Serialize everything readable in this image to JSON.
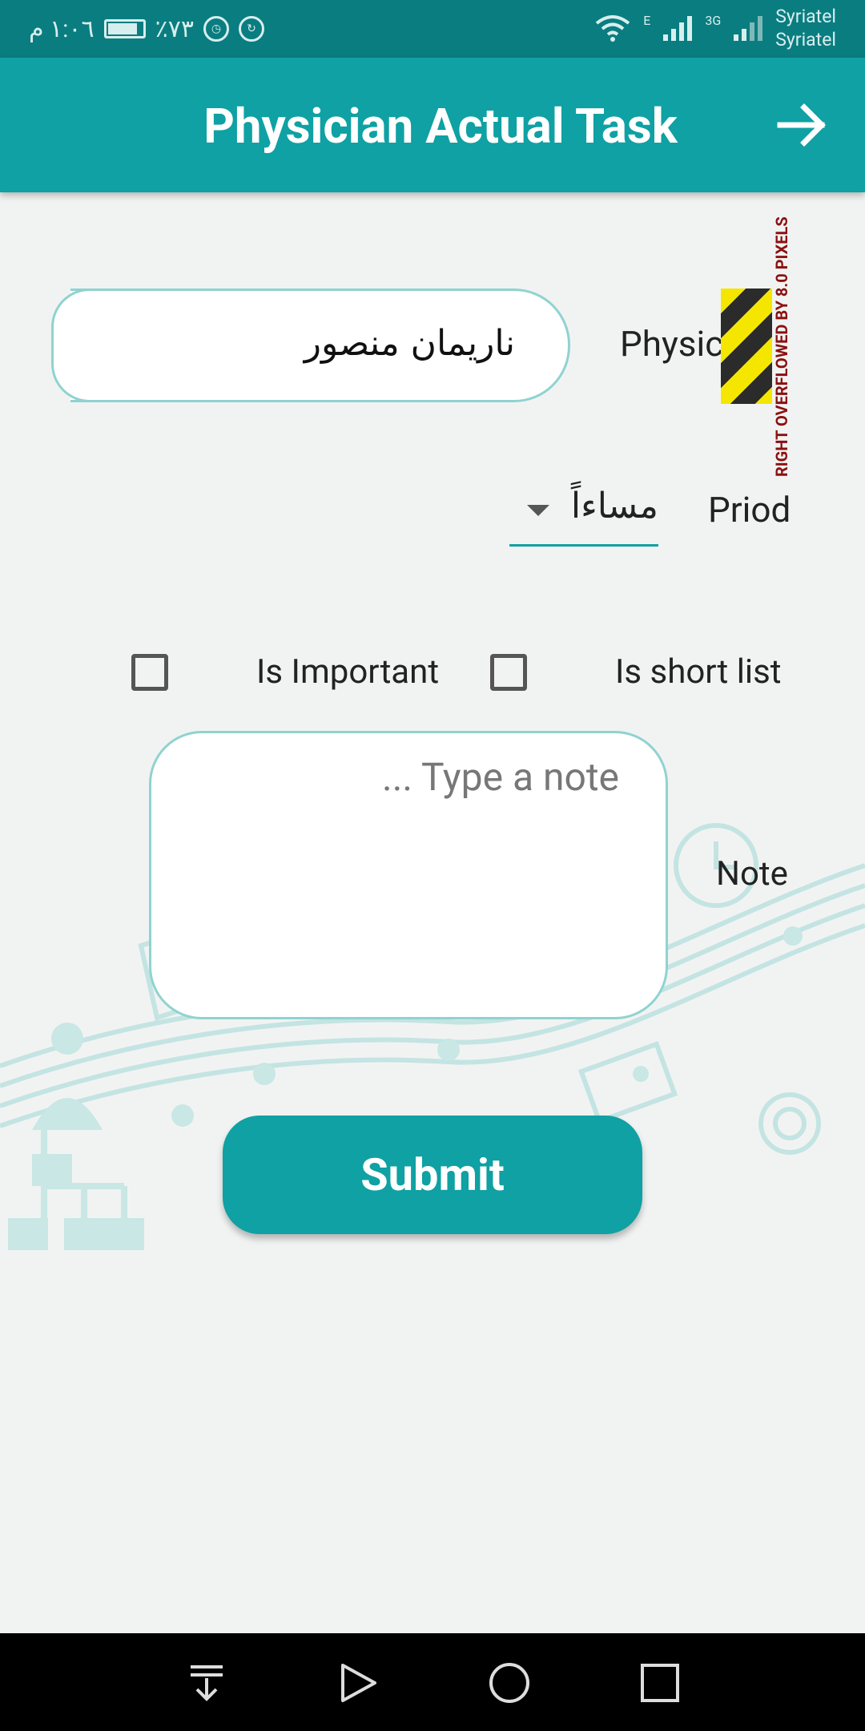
{
  "status_bar": {
    "time": "١:٠٦ م",
    "battery": "٪٧٣",
    "carrier_1": "Syriatel",
    "carrier_2": "Syriatel",
    "network_1": "E",
    "network_2": "3G"
  },
  "app_bar": {
    "title": "Physician Actual Task"
  },
  "form": {
    "physician_label": "Physician",
    "physician_value": "ناريمان منصور",
    "period_label": "Priod",
    "period_value": "مساءاً",
    "is_important_label": "Is Important",
    "is_short_list_label": "Is short list",
    "note_label": "Note",
    "note_placeholder": "... Type a note",
    "submit_label": "Submit",
    "overflow_warning": "RIGHT OVERFLOWED BY 8.0 PIXELS"
  },
  "colors": {
    "primary": "#0fa1a3",
    "status_bar": "#0a7d80",
    "field_border": "#8fd3d0",
    "background": "#f1f3f2"
  }
}
